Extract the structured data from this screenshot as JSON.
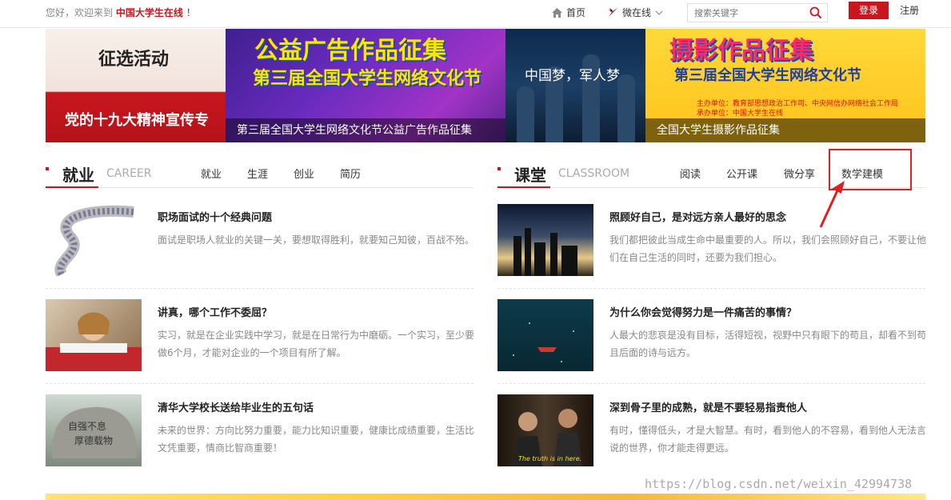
{
  "topbar": {
    "greeting": "您好，欢迎来到",
    "site_name": "中国大学生在线",
    "excl": "！",
    "home": "首页",
    "weizaixian": "微在线",
    "search_placeholder": "搜索关键字",
    "login": "登录",
    "register": "注册"
  },
  "banner": [
    {
      "big": "征选活动",
      "caption": "党的十九大精神宣传专"
    },
    {
      "title1": "公益广告作品征集",
      "title2": "第三届全国大学生网络文化节",
      "caption": "第三届全国大学生网络文化节公益广告作品征集"
    },
    {
      "caption": "中国梦，军人梦"
    },
    {
      "title1": "摄影作品征集",
      "title2": "第三届全国大学生网络文化节",
      "small1": "主办单位：教育部思想政治工作司、中央网信办网络社会工作局",
      "small2": "承办单位：中国大学生在线",
      "caption": "全国大学生摄影作品征集"
    }
  ],
  "jiuye": {
    "title": "就业",
    "en": "CAREER",
    "tabs": [
      "就业",
      "生涯",
      "创业",
      "简历"
    ],
    "items": [
      {
        "title": "职场面试的十个经典问题",
        "desc": "面试是职场人就业的关键一关，要想取得胜利，就要知己知彼，百战不殆。"
      },
      {
        "title": "讲真，哪个工作不委屈？",
        "desc": "实习，就是在企业实践中学习，就是在日常行为中磨砺。一个实习，至少要做6个月，才能对企业的一个项目有所了解。"
      },
      {
        "title": "清华大学校长送给毕业生的五句话",
        "desc": "未来的世界：方向比努力重要，能力比知识重要，健康比成绩重要，生活比文凭重要，情商比智商重要！"
      }
    ]
  },
  "ketang": {
    "title": "课堂",
    "en": "CLASSROOM",
    "tabs": [
      "阅读",
      "公开课",
      "微分享",
      "数学建模"
    ],
    "items": [
      {
        "title": "照顾好自己，是对远方亲人最好的思念",
        "desc": "我们都把彼此当成生命中最重要的人。所以，我们会照顾好自己，不要让他们在自己生活的同时，还要为我们担心。"
      },
      {
        "title": "为什么你会觉得努力是一件痛苦的事情？",
        "desc": "人最大的悲哀是没有目标，活得短视，视野中只有眼下的苟且，却看不到苟且后面的诗与远方。"
      },
      {
        "title": "深到骨子里的成熟，就是不要轻易指责他人",
        "desc": "有时，懂得低头，才是大智慧。有时，看到他人的不容易，看到他人无法言说的世界，你才能走得更远。",
        "thumb_caption": "The truth is in here."
      }
    ]
  },
  "thumbs": {
    "stone_text1": "自强不息",
    "stone_text2": "厚德载物"
  },
  "watermark": "https://blog.csdn.net/weixin_42994738"
}
